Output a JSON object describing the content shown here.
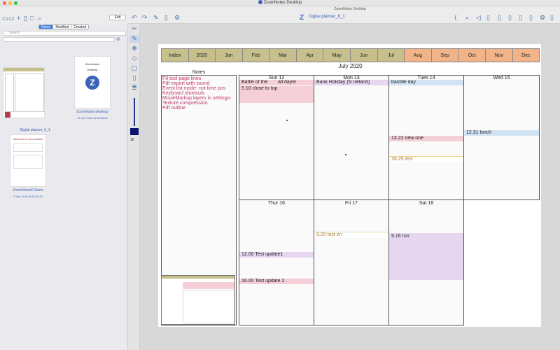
{
  "window": {
    "title": "ZoomNotes Desktop",
    "subtitle": "ZoomNotes Desktop",
    "doc_title": "Digital planner_6_1"
  },
  "toolbar": {
    "edit_label": "Edit"
  },
  "sidebar": {
    "sort_tabs": [
      "Name",
      "Modified",
      "Created"
    ],
    "search_placeholder": "Search",
    "items": [
      {
        "label": "Digital planner_6_1",
        "date": ""
      },
      {
        "label": "ZoomNotes Desktop",
        "date": "30 Jun 2020 at 06:08:05"
      },
      {
        "label": "ZoomNotes6 Demo",
        "date": "2 Sep 2019 at 06:09:25"
      }
    ]
  },
  "planner": {
    "tabs": [
      "Index",
      "2020",
      "Jan",
      "Feb",
      "Mar",
      "Apr",
      "May",
      "Jun",
      "Jul",
      "Aug",
      "Sep",
      "Oct",
      "Nov",
      "Dec"
    ],
    "month_title": "July 2020",
    "notes_title": "Notes",
    "notes": [
      "F8 tool page lines",
      "Pdf export with sound",
      "Event list mode- not time pos",
      "Keyboard shortcuts",
      "MovieMarkup layers in settings-",
      "Texture compression",
      "Pdf outline"
    ],
    "days": [
      "Sun 12",
      "Mon 13",
      "Tues 14",
      "Wed 15",
      "Thur 16",
      "Fri 17",
      "Sat 18"
    ],
    "events": {
      "sun_allday1": "Battle of the",
      "sun_allday2": "all dayer",
      "sun_510": "5.10 close to top",
      "mon_holiday": "Bank Holiday (N Ireland)",
      "tue_bastille": "bastille day",
      "tue_1322": "13.22 new one",
      "tue_1625": "16.25 test",
      "wed_1231": "12.31 lunch",
      "thu_1200": "12.00 Test update1",
      "thu_1600": "16.00 Test update 2",
      "fri_900": "9.00 test zn",
      "sat_916": "9.16 run"
    }
  },
  "colors": {
    "accent": "#3d7de0",
    "tab_gold": "#c8c08c",
    "tab_orange": "#f0b488",
    "event_pink": "#f5cfd8",
    "event_purple": "#e6d6ef",
    "event_blue": "#d2e4f3",
    "event_yellow": "#f7f0c8",
    "event_green": "#e8f2d6",
    "note_text": "#c0336b"
  },
  "sidebar_pen_value": "16"
}
